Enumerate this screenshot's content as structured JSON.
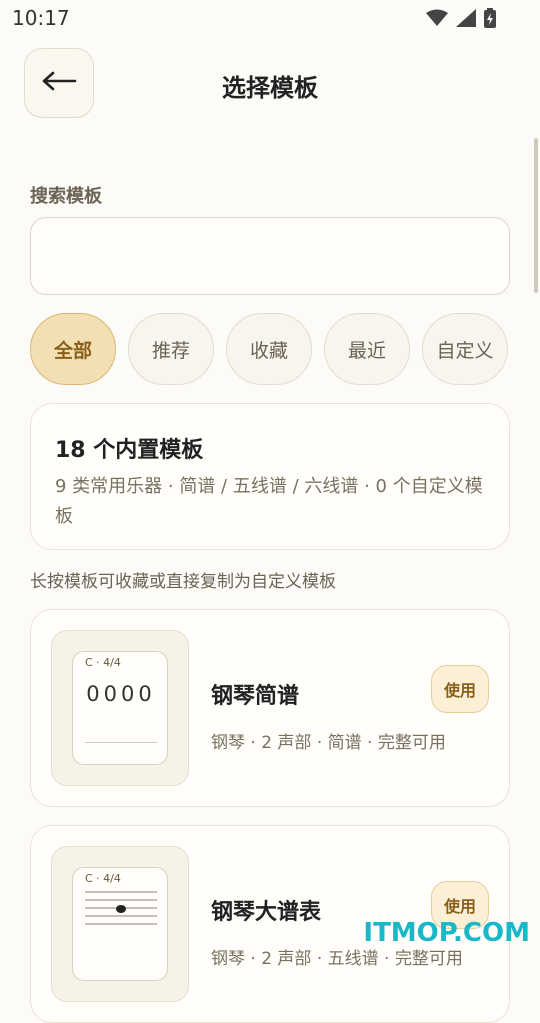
{
  "status_bar": {
    "time": "10:17",
    "icons": [
      "wifi-icon",
      "cell-signal-icon",
      "battery-charging-icon"
    ]
  },
  "header": {
    "back_icon": "arrow-left-icon",
    "title": "选择模板"
  },
  "search": {
    "label": "搜索模板",
    "value": "",
    "placeholder": ""
  },
  "filters": [
    {
      "label": "全部",
      "active": true
    },
    {
      "label": "推荐",
      "active": false
    },
    {
      "label": "收藏",
      "active": false
    },
    {
      "label": "最近",
      "active": false
    },
    {
      "label": "自定义",
      "active": false
    }
  ],
  "summary": {
    "title": "18 个内置模板",
    "description": "9 类常用乐器 · 简谱 / 五线谱 / 六线谱 · 0 个自定义模板"
  },
  "hint": "长按模板可收藏或直接复制为自定义模板",
  "templates": [
    {
      "name": "钢琴简谱",
      "meta": "钢琴 · 2 声部 · 简谱 · 完整可用",
      "thumb_key": "C · 4/4",
      "thumb_notes": "0000",
      "action": "使用"
    },
    {
      "name": "钢琴大谱表",
      "meta": "钢琴 · 2 声部 · 五线谱 · 完整可用",
      "thumb_key": "C · 4/4",
      "action": "使用"
    }
  ],
  "watermark": "ITMOP.COM",
  "colors": {
    "background": "#fcfbf7",
    "accent": "#8a6118",
    "accent_bg": "#f3dfb4",
    "watermark": "#19b8c7"
  }
}
